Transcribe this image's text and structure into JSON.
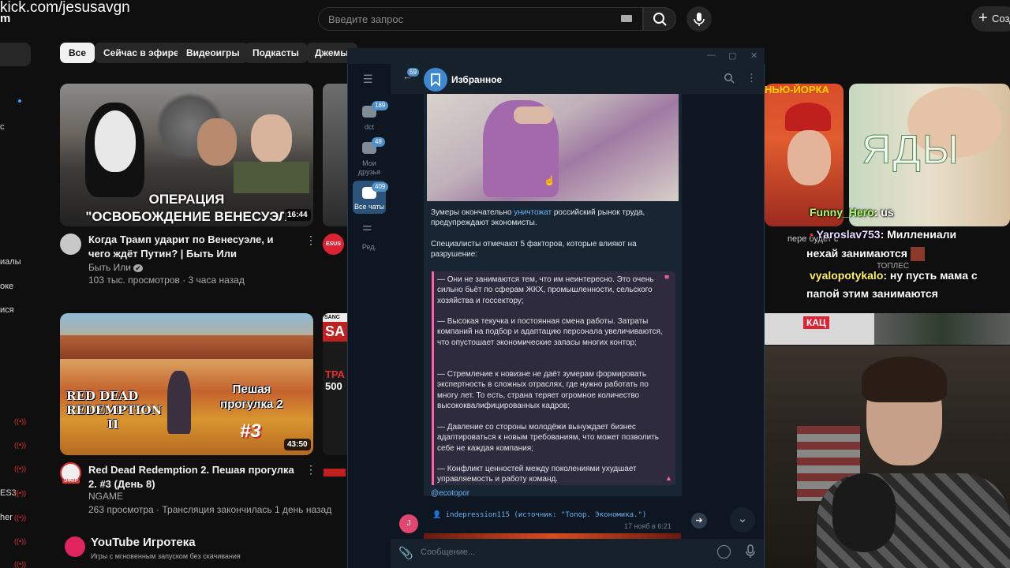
{
  "overlay": {
    "kick_url": "kick.com/jesusavgn",
    "kick_frag": "m"
  },
  "youtube": {
    "search_placeholder": "Введите запрос",
    "create_label": "Созд",
    "chips": [
      "Все",
      "Сейчас в эфире",
      "Видеоигры",
      "Подкасты",
      "Джемы"
    ],
    "sidebar_fragments": [
      "с",
      "иалы",
      "оке",
      "ися",
      "ES3",
      "her"
    ],
    "videos": [
      {
        "caption_top": "ОПЕРАЦИЯ",
        "caption_bottom": "\"ОСВОБОЖДЕНИЕ ВЕНЕСУЭЛ",
        "duration": "16:44",
        "title": "Когда Трамп ударит по Венесуэле, и чего ждёт Путин? | Быть Или",
        "channel": "Быть Или",
        "verified": "✔",
        "meta": "103 тыс. просмотров · 3 часа назад"
      },
      {
        "caption_left_1": "RED DEAD",
        "caption_left_2": "REDEMPTION",
        "caption_left_3": "II",
        "caption_right": "Пешая прогулка 2",
        "caption_num": "#3",
        "duration": "43:50",
        "title": "Red Dead Redemption 2. Пешая прогулка 2. #3 (День 8)",
        "channel": "NGAME",
        "channel_badge": "ЭФИР",
        "meta": "263 просмотра · Трансляция закончилась 1 день назад"
      }
    ],
    "strip_fragments": [
      "ESUS",
      "SANC",
      "SA",
      "ТРА",
      "500"
    ],
    "playables": {
      "title": "YouTube Игротека",
      "subtitle": "Игры с мгновенным запуском без скачивания"
    },
    "right_thumbs": {
      "top_caption": "НЬЮ-ЙОРКА",
      "yady": "ЯДЫ",
      "kac": "КАЦ",
      "meta_frag": "ТОПЛЕС",
      "meta_frag2": "пере будет с"
    }
  },
  "twitch_chat": [
    {
      "user": "Funny_Hero",
      "text": ": us",
      "color": "#a8ff60"
    },
    {
      "user": "Yaroslav753",
      "text": ": Миллениали",
      "color": "#e9d9ff"
    },
    {
      "user": "",
      "text": "нехай занимаются",
      "color": "#ffffff"
    },
    {
      "user": "vyalopotykalo",
      "text": ": ну пусть мама с",
      "color": "#fff25c"
    },
    {
      "user": "",
      "text": "папой этим занимаются",
      "color": "#ffffff"
    }
  ],
  "telegram": {
    "chat_title": "Избранное",
    "back_badge": "59",
    "folders": [
      {
        "label": "dct",
        "badge": "189",
        "active": false
      },
      {
        "label": "Мои друзья",
        "badge": "48",
        "active": false
      },
      {
        "label": "Все чаты",
        "badge": "409",
        "active": true
      },
      {
        "label": "Ред.",
        "badge": "",
        "active": false
      }
    ],
    "message": {
      "intro_1": "Зумеры окончательно ",
      "intro_link": "уничтожат",
      "intro_2": " российский рынок труда, предупреждают экономисты.",
      "para2": "Специалисты отмечают 5 факторов, которые влияют на разрушение:",
      "quote_items": [
        "— Они не занимаются тем, что им неинтересно. Это очень сильно бьёт по сферам ЖКХ, промышленности, сельского хозяйства и госсектору;",
        "— Высокая текучка и постоянная смена работы. Затраты компаний на подбор и адаптацию персонала увеличиваются, что опустошает экономические запасы многих контор;",
        "— Стремление к новизне не даёт зумерам формировать экспертность в сложных отраслях, где нужно работать по многу лет. То есть, страна теряет огромное количество высококвалифицированных кадров;",
        "— Давление со стороны молодёжи вынуждает бизнес адаптироваться к новым требованиям, что может позволить себе не каждая компания;",
        "— Конфликт ценностей между поколениями ухудшает управляемость и работу команд."
      ],
      "handle": "@ecotopor",
      "source": "👤 indepression115 (источник: \"Топор. Экономика.\")",
      "time": "17 нояб в 6:21",
      "sender_initial": "J"
    },
    "composer_placeholder": "Сообщение..."
  }
}
